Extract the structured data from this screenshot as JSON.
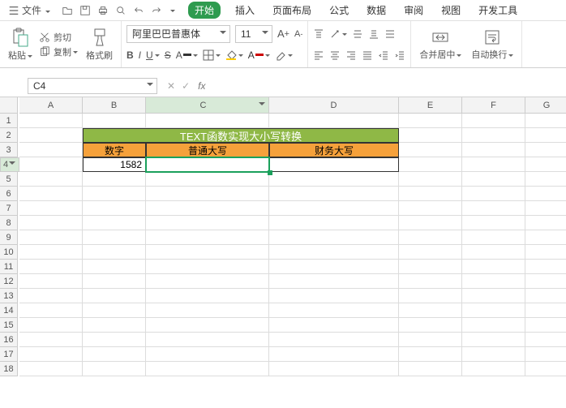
{
  "menubar": {
    "file": "文件",
    "tabs": [
      "开始",
      "插入",
      "页面布局",
      "公式",
      "数据",
      "审阅",
      "视图",
      "开发工具"
    ],
    "active_tab_index": 0
  },
  "ribbon": {
    "clipboard": {
      "cut": "剪切",
      "copy": "复制",
      "paste": "粘贴",
      "format_painter": "格式刷"
    },
    "font": {
      "name": "阿里巴巴普惠体",
      "size": "11"
    },
    "merge_center": "合并居中",
    "wrap_text": "自动换行"
  },
  "namebox": {
    "value": "C4"
  },
  "formula": {
    "fx": "fx",
    "value": ""
  },
  "columns": [
    "A",
    "B",
    "C",
    "D",
    "E",
    "F",
    "G"
  ],
  "rows": [
    "1",
    "2",
    "3",
    "4",
    "5",
    "6",
    "7",
    "8",
    "9",
    "10",
    "11",
    "12",
    "13",
    "14",
    "15",
    "16",
    "17",
    "18"
  ],
  "selected_col": "C",
  "selected_row": "4",
  "content": {
    "title": "TEXT函数实现大小写转换",
    "hdr_b": "数字",
    "hdr_c": "普通大写",
    "hdr_d": "财务大写",
    "b4": "1582"
  }
}
